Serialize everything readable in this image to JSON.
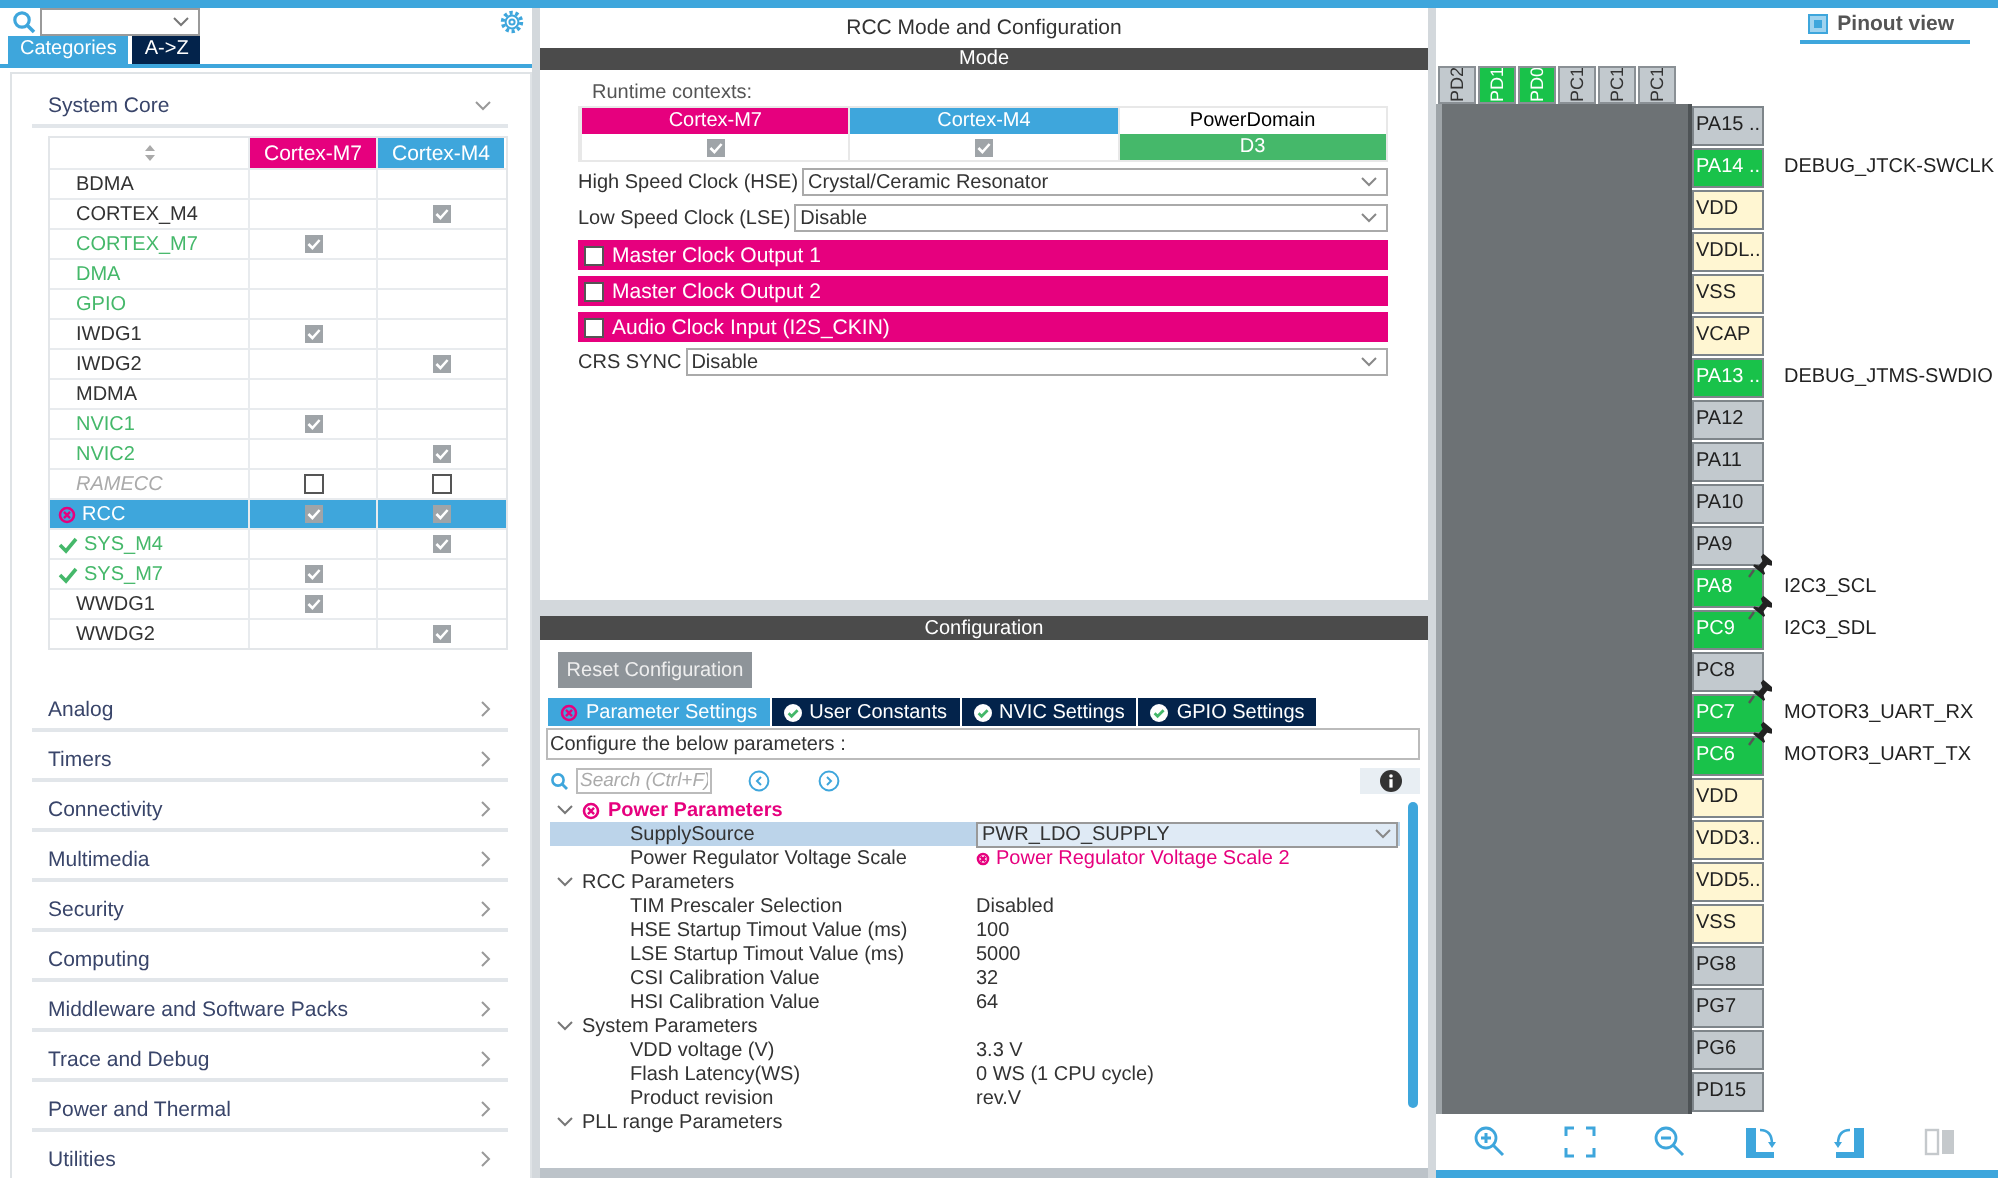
{
  "left_tabs": [
    {
      "label": "Categories",
      "selected": true
    },
    {
      "label": "A->Z",
      "selected": false
    }
  ],
  "categories": [
    {
      "label": "System Core",
      "expanded": true,
      "table": {
        "columns": [
          {
            "label": "Cortex-M7",
            "color": "#e6007e"
          },
          {
            "label": "Cortex-M4",
            "color": "#3ea6dc"
          }
        ],
        "rows": [
          {
            "name": "BDMA",
            "kind": "none",
            "selected": false
          },
          {
            "name": "CORTEX_M4",
            "kind": "none",
            "selected": false,
            "m4": true
          },
          {
            "name": "CORTEX_M7",
            "kind": "configured",
            "selected": false,
            "m7": true
          },
          {
            "name": "DMA",
            "kind": "configured",
            "selected": false
          },
          {
            "name": "GPIO",
            "kind": "configured",
            "selected": false
          },
          {
            "name": "IWDG1",
            "kind": "none",
            "selected": false,
            "m7": true
          },
          {
            "name": "IWDG2",
            "kind": "none",
            "selected": false,
            "m4": true
          },
          {
            "name": "MDMA",
            "kind": "none",
            "selected": false
          },
          {
            "name": "NVIC1",
            "kind": "configured",
            "selected": false,
            "m7": true
          },
          {
            "name": "NVIC2",
            "kind": "configured",
            "selected": false,
            "m4": true
          },
          {
            "name": "RAMECC",
            "kind": "disabled",
            "selected": false,
            "m7": false,
            "m4": false
          },
          {
            "name": "RCC",
            "kind": "error",
            "selected": true,
            "m7": true,
            "m4": true
          },
          {
            "name": "SYS_M4",
            "kind": "ok",
            "selected": false,
            "m4": true
          },
          {
            "name": "SYS_M7",
            "kind": "ok",
            "selected": false,
            "m7": true
          },
          {
            "name": "WWDG1",
            "kind": "none",
            "selected": false,
            "m7": true
          },
          {
            "name": "WWDG2",
            "kind": "none",
            "selected": false,
            "m4": true
          }
        ]
      }
    },
    {
      "label": "Analog",
      "expanded": false
    },
    {
      "label": "Timers",
      "expanded": false
    },
    {
      "label": "Connectivity",
      "expanded": false
    },
    {
      "label": "Multimedia",
      "expanded": false
    },
    {
      "label": "Security",
      "expanded": false
    },
    {
      "label": "Computing",
      "expanded": false
    },
    {
      "label": "Middleware and Software Packs",
      "expanded": false
    },
    {
      "label": "Trace and Debug",
      "expanded": false
    },
    {
      "label": "Power and Thermal",
      "expanded": false
    },
    {
      "label": "Utilities",
      "expanded": false
    }
  ],
  "mode": {
    "title": "RCC Mode and Configuration",
    "header": "Mode",
    "runtime_label": "Runtime contexts:",
    "contexts": [
      {
        "label": "Cortex-M7",
        "color": "#e6007e",
        "kind": "check",
        "checked": true
      },
      {
        "label": "Cortex-M4",
        "color": "#3ea6dc",
        "kind": "check",
        "checked": true
      },
      {
        "label": "PowerDomain",
        "color": "#ffffff",
        "kind": "domain",
        "value": "D3"
      }
    ],
    "fields": [
      {
        "kind": "select",
        "label": "High Speed Clock (HSE)",
        "value": "Crystal/Ceramic Resonator"
      },
      {
        "kind": "select",
        "label": "Low Speed Clock (LSE)",
        "value": "Disable"
      },
      {
        "kind": "checkbox",
        "label": "Master Clock Output 1",
        "checked": false
      },
      {
        "kind": "checkbox",
        "label": "Master Clock Output 2",
        "checked": false
      },
      {
        "kind": "checkbox",
        "label": "Audio Clock Input (I2S_CKIN)",
        "checked": false
      },
      {
        "kind": "select",
        "label": "CRS SYNC",
        "value": "Disable"
      }
    ]
  },
  "configuration": {
    "header": "Configuration",
    "reset_button": "Reset Configuration",
    "tabs": [
      {
        "label": "Parameter Settings",
        "kind": "error",
        "selected": true
      },
      {
        "label": "User Constants",
        "kind": "ok",
        "selected": false
      },
      {
        "label": "NVIC Settings",
        "kind": "ok",
        "selected": false
      },
      {
        "label": "GPIO Settings",
        "kind": "ok",
        "selected": false
      }
    ],
    "hint": "Configure the below parameters :",
    "search": {
      "placeholder": "Search (Ctrl+F)"
    },
    "groups": [
      {
        "label": "Power Parameters",
        "kind": "error",
        "expanded": true,
        "params": [
          {
            "name": "SupplySource",
            "value": "PWR_LDO_SUPPLY",
            "kind": "dropdown",
            "selected": true
          },
          {
            "name": "Power Regulator Voltage Scale",
            "value": "Power Regulator Voltage Scale 2",
            "kind": "error",
            "selected": false
          }
        ]
      },
      {
        "label": "RCC Parameters",
        "kind": "none",
        "expanded": true,
        "params": [
          {
            "name": "TIM Prescaler Selection",
            "value": "Disabled",
            "kind": "text",
            "selected": false
          },
          {
            "name": "HSE Startup Timout Value (ms)",
            "value": "100",
            "kind": "text",
            "selected": false
          },
          {
            "name": "LSE Startup Timout Value (ms)",
            "value": "5000",
            "kind": "text",
            "selected": false
          },
          {
            "name": "CSI Calibration Value",
            "value": "32",
            "kind": "text",
            "selected": false
          },
          {
            "name": "HSI Calibration Value",
            "value": "64",
            "kind": "text",
            "selected": false
          }
        ]
      },
      {
        "label": "System Parameters",
        "kind": "none",
        "expanded": true,
        "params": [
          {
            "name": "VDD voltage (V)",
            "value": "3.3 V",
            "kind": "text",
            "selected": false
          },
          {
            "name": "Flash Latency(WS)",
            "value": "0 WS (1 CPU cycle)",
            "kind": "text",
            "selected": false
          },
          {
            "name": "Product revision",
            "value": "rev.V",
            "kind": "text",
            "selected": false
          }
        ]
      },
      {
        "label": "PLL range Parameters",
        "kind": "none",
        "expanded": true
      }
    ]
  },
  "pinout": {
    "tab": {
      "label": "Pinout view",
      "selected": true
    },
    "top_pins": [
      {
        "label": "PD2",
        "assigned": false
      },
      {
        "label": "PD1",
        "assigned": true
      },
      {
        "label": "PD0",
        "assigned": true
      },
      {
        "label": "PC1",
        "assigned": false
      },
      {
        "label": "PC1",
        "assigned": false
      },
      {
        "label": "PC1",
        "assigned": false
      }
    ],
    "pins": [
      {
        "label": "PA15 ..",
        "kind": "io",
        "pinned": false
      },
      {
        "label": "PA14 ..",
        "kind": "assigned",
        "signal": "DEBUG_JTCK-SWCLK",
        "pinned": false
      },
      {
        "label": "VDD",
        "kind": "power",
        "pinned": false
      },
      {
        "label": "VDDL..",
        "kind": "power",
        "pinned": false
      },
      {
        "label": "VSS",
        "kind": "power",
        "pinned": false
      },
      {
        "label": "VCAP",
        "kind": "power",
        "pinned": false
      },
      {
        "label": "PA13 ..",
        "kind": "assigned",
        "signal": "DEBUG_JTMS-SWDIO",
        "pinned": false
      },
      {
        "label": "PA12",
        "kind": "io",
        "pinned": false
      },
      {
        "label": "PA11",
        "kind": "io",
        "pinned": false
      },
      {
        "label": "PA10",
        "kind": "io",
        "pinned": false
      },
      {
        "label": "PA9",
        "kind": "io",
        "pinned": false
      },
      {
        "label": "PA8",
        "kind": "assigned",
        "signal": "I2C3_SCL",
        "pinned": true
      },
      {
        "label": "PC9",
        "kind": "assigned",
        "signal": "I2C3_SDL",
        "pinned": true
      },
      {
        "label": "PC8",
        "kind": "io",
        "pinned": false
      },
      {
        "label": "PC7",
        "kind": "assigned",
        "signal": "MOTOR3_UART_RX",
        "pinned": true
      },
      {
        "label": "PC6",
        "kind": "assigned",
        "signal": "MOTOR3_UART_TX",
        "pinned": true
      },
      {
        "label": "VDD",
        "kind": "power",
        "pinned": false
      },
      {
        "label": "VDD3..",
        "kind": "power",
        "pinned": false
      },
      {
        "label": "VDD5..",
        "kind": "power",
        "pinned": false
      },
      {
        "label": "VSS",
        "kind": "power",
        "pinned": false
      },
      {
        "label": "PG8",
        "kind": "io",
        "pinned": false
      },
      {
        "label": "PG7",
        "kind": "io",
        "pinned": false
      },
      {
        "label": "PG6",
        "kind": "io",
        "pinned": false
      },
      {
        "label": "PD15",
        "kind": "io",
        "pinned": false
      }
    ]
  }
}
